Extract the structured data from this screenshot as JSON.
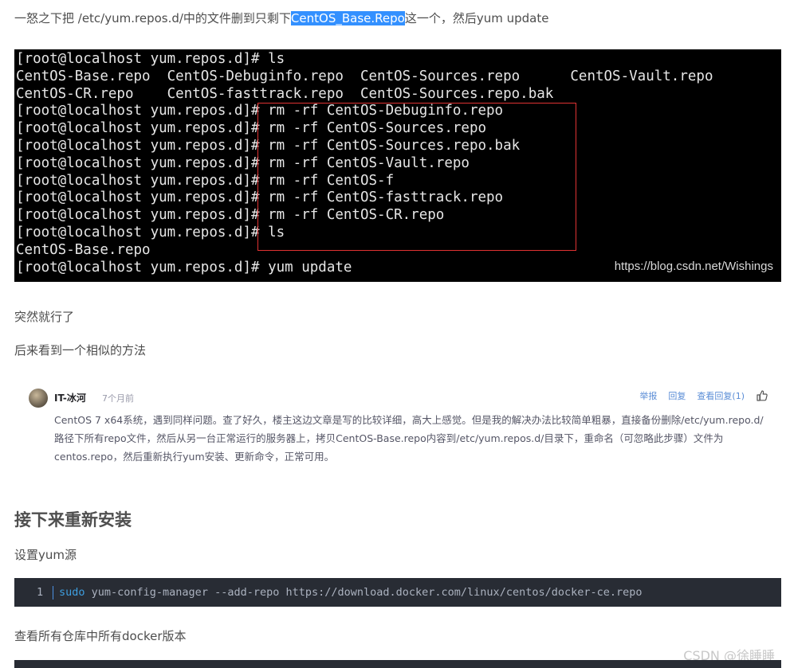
{
  "intro": {
    "before": "一怒之下把 /etc/yum.repos.d/中的文件删到只剩下",
    "highlight": "CentOS_Base.Repo",
    "after": "这一个，然后yum update"
  },
  "terminal": {
    "lines": [
      "[root@localhost yum.repos.d]# ls",
      "CentOS-Base.repo  CentOS-Debuginfo.repo  CentOS-Sources.repo      CentOS-Vault.repo",
      "CentOS-CR.repo    CentOS-fasttrack.repo  CentOS-Sources.repo.bak",
      "[root@localhost yum.repos.d]# rm -rf CentOS-Debuginfo.repo",
      "[root@localhost yum.repos.d]# rm -rf CentOS-Sources.repo",
      "[root@localhost yum.repos.d]# rm -rf CentOS-Sources.repo.bak",
      "[root@localhost yum.repos.d]# rm -rf CentOS-Vault.repo",
      "[root@localhost yum.repos.d]# rm -rf CentOS-f",
      "[root@localhost yum.repos.d]# rm -rf CentOS-fasttrack.repo",
      "[root@localhost yum.repos.d]# rm -rf CentOS-CR.repo",
      "[root@localhost yum.repos.d]# ls",
      "CentOS-Base.repo",
      "[root@localhost yum.repos.d]# yum update"
    ],
    "watermark": "https://blog.csdn.net/Wishings"
  },
  "para1": "突然就行了",
  "para2": "后来看到一个相似的方法",
  "comment": {
    "user": "IT-冰河",
    "time": "7个月前",
    "actions": {
      "report": "举报",
      "reply": "回复",
      "view_replies": "查看回复(1)"
    },
    "body": "CentOS 7 x64系统，遇到同样问题。查了好久，楼主这边文章是写的比较详细，高大上感觉。但是我的解决办法比较简单粗暴，直接备份删除/etc/yum.repo.d/路径下所有repo文件，然后从另一台正常运行的服务器上，拷贝CentOS-Base.repo内容到/etc/yum.repos.d/目录下，重命名（可忽略此步骤）文件为centos.repo，然后重新执行yum安装、更新命令，正常可用。"
  },
  "section_title": "接下来重新安装",
  "para3": "设置yum源",
  "code1": {
    "line_number": "1",
    "keyword": "sudo",
    "rest": " yum-config-manager --add-repo https://download.docker.com/linux/centos/docker-ce.repo"
  },
  "para4": "查看所有仓库中所有docker版本",
  "footer_watermark": "CSDN @徐睡睡",
  "colors": {
    "highlight": "#3390ff",
    "terminal_bg": "#000000",
    "code_bg": "#282c34",
    "link": "#5a8dd6",
    "red_box": "#e03232"
  }
}
